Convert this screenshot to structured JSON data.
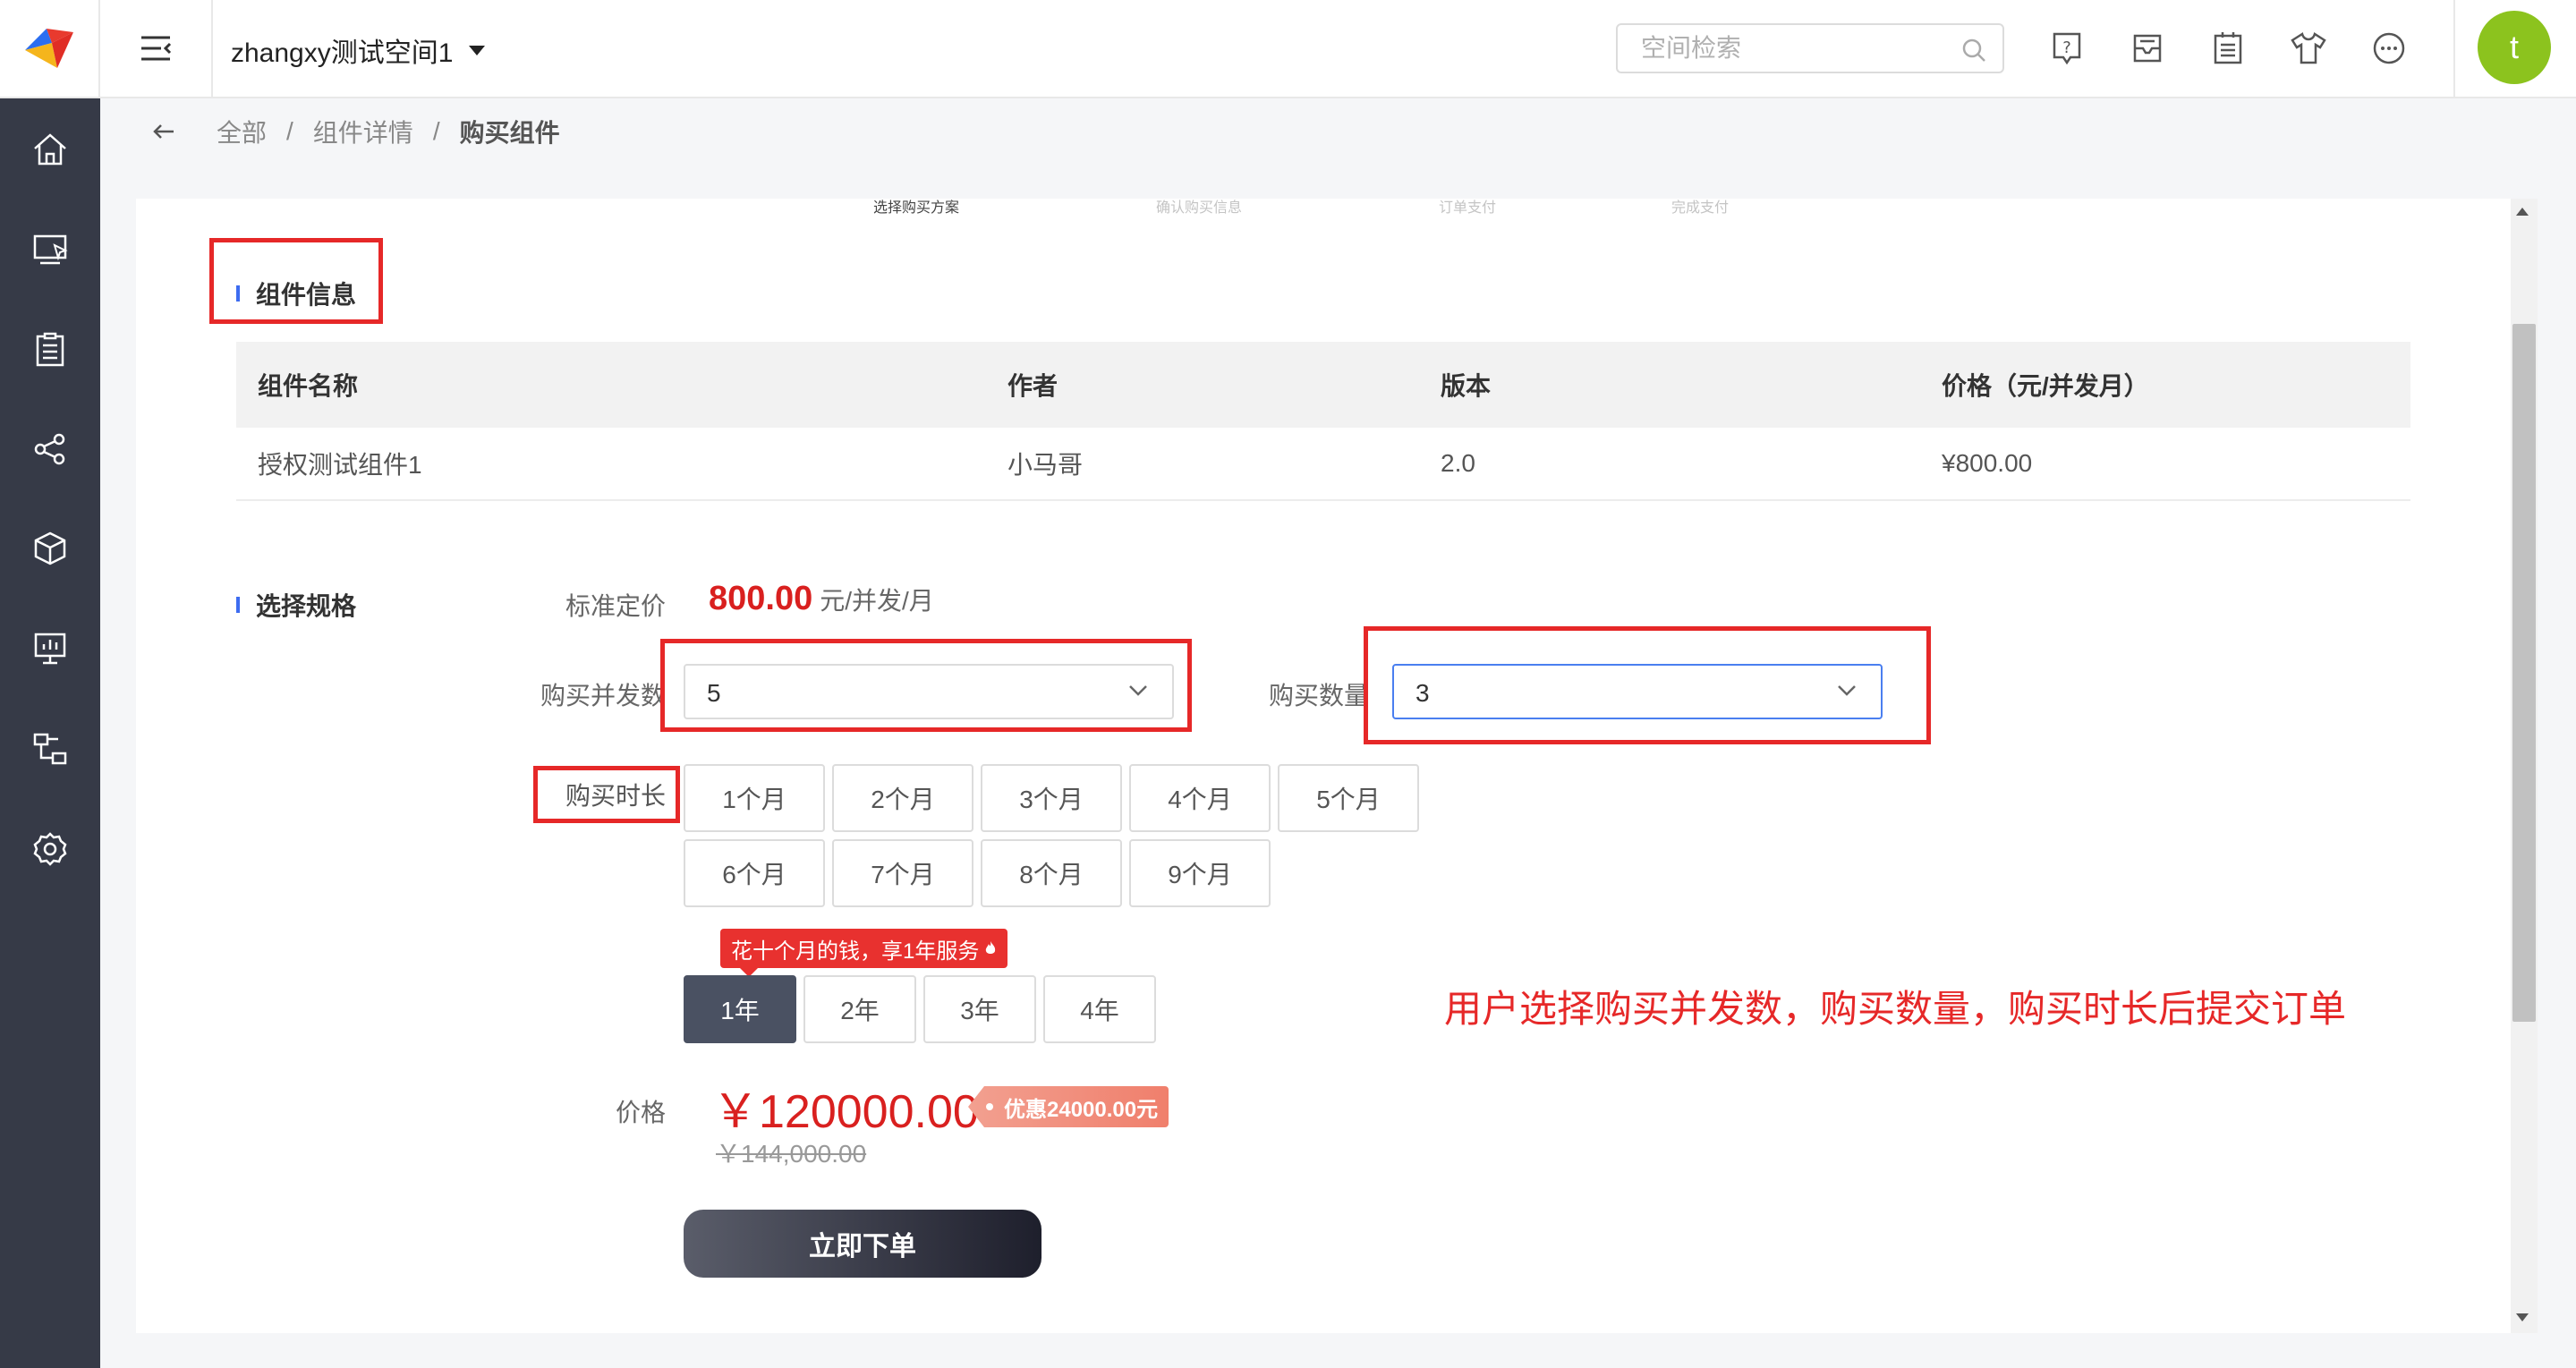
{
  "header": {
    "space_name": "zhangxy测试空间1",
    "search_placeholder": "空间检索",
    "icons": [
      "help-icon",
      "inbox-icon",
      "clipboard-icon",
      "tshirt-icon",
      "chat-icon"
    ],
    "avatar_letter": "t",
    "avatar_color": "#8cc31e"
  },
  "sidebar": {
    "items": [
      "home-icon",
      "monitor-icon",
      "tasks-icon",
      "share-icon",
      "package-icon",
      "dashboard-icon",
      "flow-icon",
      "settings-icon"
    ]
  },
  "breadcrumb": {
    "items": [
      "全部",
      "组件详情"
    ],
    "current": "购买组件"
  },
  "steps": [
    "选择购买方案",
    "确认购买信息",
    "订单支付",
    "完成支付"
  ],
  "component_info": {
    "title": "组件信息",
    "columns": [
      "组件名称",
      "作者",
      "版本",
      "价格（元/并发月）"
    ],
    "row": [
      "授权测试组件1",
      "小马哥",
      "2.0",
      "¥800.00"
    ]
  },
  "spec": {
    "title": "选择规格",
    "std_price_label": "标准定价",
    "std_price_value": "800.00",
    "std_price_unit": "元/并发/月",
    "concurrency_label": "购买并发数",
    "concurrency_value": "5",
    "quantity_label": "购买数量",
    "quantity_value": "3",
    "duration_label": "购买时长",
    "months": [
      "1个月",
      "2个月",
      "3个月",
      "4个月",
      "5个月",
      "6个月",
      "7个月",
      "8个月",
      "9个月"
    ],
    "promo": "花十个月的钱，享1年服务",
    "years": [
      "1年",
      "2年",
      "3年",
      "4年"
    ],
    "selected_year": "1年",
    "price_label": "价格",
    "price_value": "￥120000.00",
    "discount": "优惠24000.00元",
    "original_price": "￥144,000.00",
    "order_button": "立即下单"
  },
  "annotation": "用户选择购买并发数，购买数量，购买时长后提交订单",
  "colors": {
    "sidebar_bg": "#363a47",
    "price_red": "#d9201f",
    "highlight_red": "#e62828",
    "step_accent": "#3d6cf0",
    "selected_year_bg": "#4a5162"
  }
}
